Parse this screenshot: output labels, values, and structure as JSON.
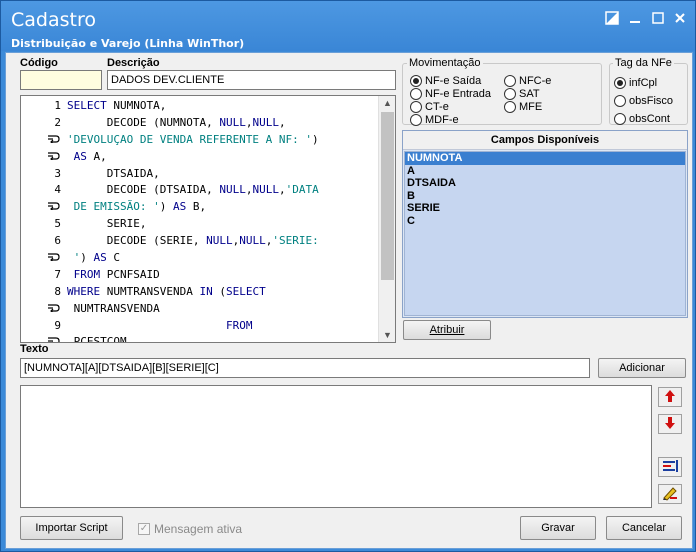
{
  "window": {
    "title": "Cadastro",
    "subtitle": "Distribuição e Varejo (Linha WinThor)"
  },
  "form": {
    "codigo_label": "Código",
    "codigo_value": "",
    "descricao_label": "Descrição",
    "descricao_value": "DADOS DEV.CLIENTE"
  },
  "sql_lines": [
    {
      "num": "1",
      "html": "<span class=\"kw\">SELECT</span> NUMNOTA,"
    },
    {
      "num": "2",
      "html": "      DECODE (NUMNOTA, <span class=\"kw\">NULL</span>,<span class=\"kw\">NULL</span>,"
    },
    {
      "num": "",
      "html": "<span class=\"str\">'DEVOLUÇAO DE VENDA REFERENTE A NF: '</span>)"
    },
    {
      "num": "",
      "html": " <span class=\"kw\">AS</span> A,"
    },
    {
      "num": "3",
      "html": "      DTSAIDA,"
    },
    {
      "num": "4",
      "html": "      DECODE (DTSAIDA, <span class=\"kw\">NULL</span>,<span class=\"kw\">NULL</span>,<span class=\"str\">'DATA</span>"
    },
    {
      "num": "",
      "html": " <span class=\"str\">DE EMISSÃO: '</span>) <span class=\"kw\">AS</span> B,"
    },
    {
      "num": "5",
      "html": "      SERIE,"
    },
    {
      "num": "6",
      "html": "      DECODE (SERIE, <span class=\"kw\">NULL</span>,<span class=\"kw\">NULL</span>,<span class=\"str\">'SERIE:</span>"
    },
    {
      "num": "",
      "html": " <span class=\"str\">'</span>) <span class=\"kw\">AS</span> C"
    },
    {
      "num": "7",
      "html": " <span class=\"kw\">FROM</span> PCNFSAID"
    },
    {
      "num": "8",
      "html": "<span class=\"kw\">WHERE</span> NUMTRANSVENDA <span class=\"kw\">IN</span> (<span class=\"kw\">SELECT</span>"
    },
    {
      "num": "",
      "html": " NUMTRANSVENDA"
    },
    {
      "num": "9",
      "html": "                        <span class=\"kw\">FROM</span>"
    },
    {
      "num": "",
      "html": " PCESTCOM"
    }
  ],
  "movimentacao": {
    "title": "Movimentação",
    "options": [
      "NF-e Saída",
      "NF-e Entrada",
      "CT-e",
      "MDF-e",
      "NFC-e",
      "SAT",
      "MFE"
    ],
    "selected": "NF-e Saída"
  },
  "tag_nfe": {
    "title": "Tag da NFe",
    "options": [
      "infCpl",
      "obsFisco",
      "obsCont"
    ],
    "selected": "infCpl"
  },
  "campos": {
    "title": "Campos Disponíveis",
    "items": [
      "NUMNOTA",
      "A",
      "DTSAIDA",
      "B",
      "SERIE",
      "C"
    ],
    "selected": "NUMNOTA"
  },
  "buttons": {
    "atribuir": "Atribuir",
    "adicionar": "Adicionar",
    "importar": "Importar Script",
    "gravar": "Gravar",
    "cancelar": "Cancelar"
  },
  "texto": {
    "label": "Texto",
    "value": "[NUMNOTA][A][DTSAIDA][B][SERIE][C]"
  },
  "mensagem_ativa": "Mensagem ativa",
  "colors": {
    "titlebar": "#3c8ad8",
    "selected_item": "#3a7fd0",
    "list_bg": "#c6d6f0"
  }
}
